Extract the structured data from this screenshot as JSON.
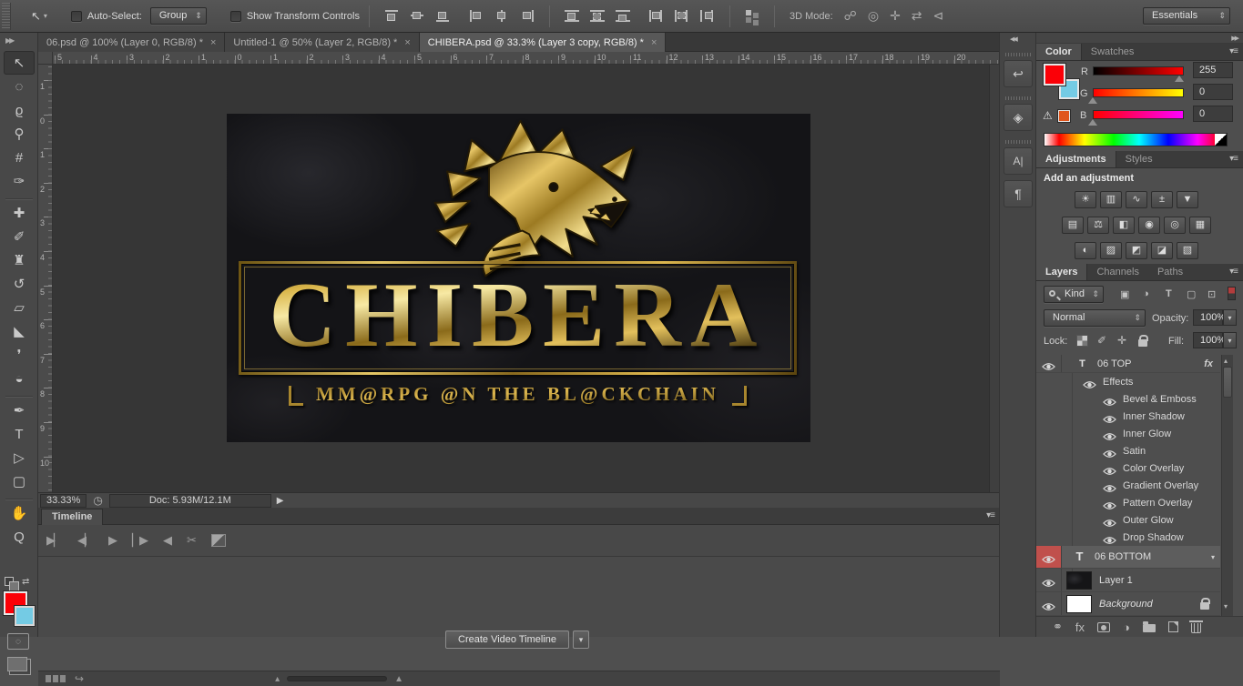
{
  "options_bar": {
    "auto_select_label": "Auto-Select:",
    "auto_select_value": "Group",
    "show_transform_label": "Show Transform Controls",
    "mode_3d_label": "3D Mode:",
    "mode_3d_icons": [
      {
        "name": "3d-orbit-icon",
        "glyph": "☍"
      },
      {
        "name": "3d-roll-icon",
        "glyph": "◎"
      },
      {
        "name": "3d-drag-icon",
        "glyph": "✛"
      },
      {
        "name": "3d-slide-icon",
        "glyph": "⇄"
      },
      {
        "name": "3d-zoom-camera-icon",
        "glyph": "⊲"
      }
    ],
    "workspace": "Essentials"
  },
  "tabs": [
    {
      "title": "06.psd @ 100% (Layer 0, RGB/8) *",
      "close": "×"
    },
    {
      "title": "Untitled-1 @ 50% (Layer 2, RGB/8) *",
      "close": "×"
    },
    {
      "title": "CHIBERA.psd @ 33.3% (Layer 3 copy, RGB/8) *",
      "close": "×"
    }
  ],
  "rulers": {
    "horizontal": [
      "5",
      "4",
      "3",
      "2",
      "1",
      "0",
      "1",
      "2",
      "3",
      "4",
      "5",
      "6",
      "7",
      "8",
      "9",
      "10",
      "11",
      "12",
      "13",
      "14",
      "15",
      "16",
      "17",
      "18",
      "19",
      "20"
    ],
    "vertical": [
      "1",
      "0",
      "1",
      "2",
      "3",
      "4",
      "5",
      "6",
      "7",
      "8",
      "9",
      "10"
    ]
  },
  "tools": [
    {
      "name": "move-tool",
      "glyph": "↖",
      "selected": true
    },
    {
      "name": "elliptical-marquee-tool",
      "glyph": "◌"
    },
    {
      "name": "lasso-tool",
      "glyph": "ϱ"
    },
    {
      "name": "quick-selection-tool",
      "glyph": "⚲"
    },
    {
      "name": "crop-tool",
      "glyph": "#"
    },
    {
      "name": "eyedropper-tool",
      "glyph": "✑"
    },
    {
      "name": "tool-divider",
      "divider": true
    },
    {
      "name": "healing-brush-tool",
      "glyph": "✚"
    },
    {
      "name": "brush-tool",
      "glyph": "✐"
    },
    {
      "name": "clone-stamp-tool",
      "glyph": "♜"
    },
    {
      "name": "history-brush-tool",
      "glyph": "↺"
    },
    {
      "name": "eraser-tool",
      "glyph": "▱"
    },
    {
      "name": "gradient-tool",
      "glyph": "◣"
    },
    {
      "name": "blur-tool",
      "glyph": "❜"
    },
    {
      "name": "dodge-tool",
      "glyph": "◒"
    },
    {
      "name": "tool-divider",
      "divider": true
    },
    {
      "name": "pen-tool",
      "glyph": "✒"
    },
    {
      "name": "type-tool",
      "glyph": "T"
    },
    {
      "name": "path-selection-tool",
      "glyph": "▷"
    },
    {
      "name": "rectangle-tool",
      "glyph": "▢"
    },
    {
      "name": "tool-divider",
      "divider": true
    },
    {
      "name": "hand-tool",
      "glyph": "✋"
    },
    {
      "name": "zoom-tool",
      "glyph": "Q"
    }
  ],
  "canvas": {
    "title": "CHIBERA",
    "tagline": "MM@RPG @N THE BL@CKCHAIN"
  },
  "status_bar": {
    "zoom": "33.33%",
    "doc_info": "Doc: 5.93M/12.1M"
  },
  "timeline": {
    "tab_label": "Timeline",
    "create_button_label": "Create Video Timeline",
    "controls": [
      {
        "name": "go-to-first-frame-icon",
        "glyph": "▶▏"
      },
      {
        "name": "previous-frame-icon",
        "glyph": "◀▏"
      },
      {
        "name": "play-icon",
        "glyph": "▶"
      },
      {
        "name": "next-frame-icon",
        "glyph": "▏▶"
      },
      {
        "name": "audio-toggle-icon",
        "glyph": "◀"
      },
      {
        "name": "scissors-icon",
        "glyph": "✂"
      },
      {
        "name": "transition-icon",
        "glyph": "",
        "css": "i-trans"
      }
    ]
  },
  "color_panel": {
    "tab_color": "Color",
    "tab_swatches": "Swatches",
    "foreground_color": "#fb0007",
    "background_color": "#74cbe4",
    "warning_swatch_color": "#e0561d",
    "channels": [
      {
        "label": "R",
        "value": "255"
      },
      {
        "label": "G",
        "value": "0"
      },
      {
        "label": "B",
        "value": "0"
      }
    ]
  },
  "adjustments_panel": {
    "tab_adjustments": "Adjustments",
    "tab_styles": "Styles",
    "heading": "Add an adjustment",
    "row1": [
      {
        "name": "brightness-contrast-icon",
        "glyph": "☀"
      },
      {
        "name": "levels-icon",
        "glyph": "▥"
      },
      {
        "name": "curves-icon",
        "glyph": "∿"
      },
      {
        "name": "exposure-icon",
        "glyph": "±"
      },
      {
        "name": "vibrance-icon",
        "glyph": "▼"
      }
    ],
    "row2": [
      {
        "name": "hue-saturation-icon",
        "glyph": "▤"
      },
      {
        "name": "color-balance-icon",
        "glyph": "⚖"
      },
      {
        "name": "black-white-icon",
        "glyph": "◧"
      },
      {
        "name": "photo-filter-icon",
        "glyph": "◉"
      },
      {
        "name": "channel-mixer-icon",
        "glyph": "◎"
      },
      {
        "name": "color-lookup-icon",
        "glyph": "▦"
      }
    ],
    "row3": [
      {
        "name": "invert-icon",
        "glyph": "◐"
      },
      {
        "name": "posterize-icon",
        "glyph": "▨"
      },
      {
        "name": "threshold-icon",
        "glyph": "◩"
      },
      {
        "name": "gradient-map-icon",
        "glyph": "◪"
      },
      {
        "name": "selective-color-icon",
        "glyph": "▧"
      }
    ]
  },
  "layers_panel": {
    "tab_layers": "Layers",
    "tab_channels": "Channels",
    "tab_paths": "Paths",
    "filter_value": "Kind",
    "blend_mode": "Normal",
    "opacity_label": "Opacity:",
    "opacity_value": "100%",
    "lock_label": "Lock:",
    "fill_label": "Fill:",
    "fill_value": "100%",
    "fx_label": "fx",
    "top_layer_name": "06 TOP",
    "effects_header": "Effects",
    "effects": [
      "Bevel & Emboss",
      "Inner Shadow",
      "Inner Glow",
      "Satin",
      "Color Overlay",
      "Gradient Overlay",
      "Pattern Overlay",
      "Outer Glow",
      "Drop Shadow"
    ],
    "bottom_layer_name": "06  BOTTOM",
    "layer1_name": "Layer 1",
    "background_name": "Background",
    "bottom_icons": [
      {
        "name": "link-layers-icon",
        "glyph": "⚭"
      },
      {
        "name": "layer-style-icon",
        "glyph": "fx",
        "css": "i-fx"
      },
      {
        "name": "layer-mask-icon",
        "glyph": "",
        "css": "i-mask"
      },
      {
        "name": "adjustment-layer-icon",
        "glyph": "◑"
      },
      {
        "name": "new-group-icon",
        "glyph": "",
        "css": "i-folder"
      },
      {
        "name": "new-layer-icon",
        "glyph": "",
        "css": "i-page"
      },
      {
        "name": "delete-layer-icon",
        "glyph": "",
        "css": "i-trash"
      }
    ]
  },
  "icons": {
    "move_tool": "↖",
    "caret": "▾",
    "panel_menu": "▾≡",
    "collapse_left": "◀◀",
    "expand_right": "▶▶",
    "expand_tools": "▶▶",
    "status_clock": "◷",
    "status_play": "▶",
    "warning": "⚠",
    "character_panel": "A|",
    "paragraph_panel": "¶",
    "history_panel": "↩",
    "threed_panel": "◈",
    "filter_image": "▣",
    "filter_adjustment": "◑",
    "filter_type": "T",
    "filter_shape": "▢",
    "filter_smart": "⊡",
    "brush_small": "✐",
    "move_cross": "✛",
    "type_thumb": "T",
    "scroll_up": "▴",
    "scroll_down": "▾",
    "fx_caret": "▾",
    "flatten_arrow": "↪",
    "zoom_out_tri": "▴",
    "zoom_in_tri": "▲",
    "quickmask_dot": "◌"
  }
}
